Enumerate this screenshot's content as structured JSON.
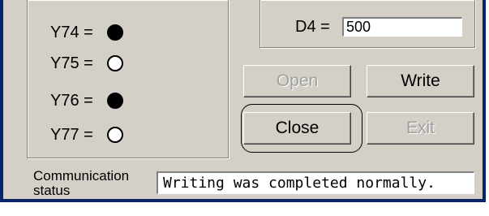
{
  "outputs": [
    {
      "label": "Y74 =",
      "state": "on"
    },
    {
      "label": "Y75 =",
      "state": "off"
    },
    {
      "label": "Y76 =",
      "state": "on"
    },
    {
      "label": "Y77 =",
      "state": "off"
    }
  ],
  "device": {
    "label": "D4 =",
    "value": "500"
  },
  "buttons": {
    "open": "Open",
    "write": "Write",
    "close": "Close",
    "exit": "Exit"
  },
  "status": {
    "label": "Communication status",
    "message": "Writing was completed normally."
  },
  "colors": {
    "window_bg": "#d4d0c8",
    "frame": "#0a246a"
  }
}
